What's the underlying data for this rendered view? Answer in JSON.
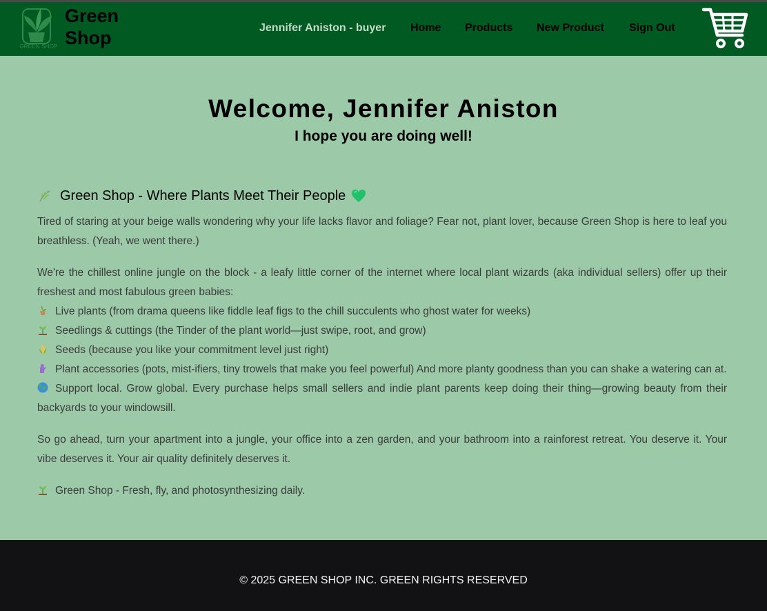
{
  "header": {
    "brand_line1": "Green",
    "brand_line2": "Shop",
    "logo_text": "GREEN SHOP",
    "user_label": "Jennifer Aniston - buyer",
    "nav": {
      "home": "Home",
      "products": "Products",
      "new_product": "New Product",
      "sign_out": "Sign Out"
    },
    "cart_icon": "shopping-cart-icon"
  },
  "hero": {
    "title": "Welcome, Jennifer Aniston",
    "subtitle": "I hope you are doing well!"
  },
  "about": {
    "title": "Green Shop - Where Plants Meet Their People",
    "intro": "Tired of staring at your beige walls wondering why your life lacks flavor and foliage? Fear not, plant lover, because Green Shop is here to leaf you breathless. (Yeah, we went there.)",
    "jungle": "We're the chillest online jungle on the block - a leafy little corner of the internet where local plant wizards (aka individual sellers) offer up their freshest and most fabulous green babies:",
    "items": [
      "Live plants (from drama queens like fiddle leaf figs to the chill succulents who ghost water for weeks)",
      "Seedlings & cuttings (the Tinder of the plant world—just swipe, root, and grow)",
      "Seeds (because you like your commitment level just right)",
      "Plant accessories (pots, mist-ifiers, tiny trowels that make you feel powerful) And more planty goodness than you can shake a watering can at.",
      "Support local. Grow global. Every purchase helps small sellers and indie plant parents keep doing their thing—growing beauty from their backyards to your windowsill."
    ],
    "outro": "So go ahead, turn your apartment into a jungle, your office into a zen garden, and your bathroom into a rainforest retreat. You deserve it. Your vibe deserves it. Your air quality definitely deserves it.",
    "tagline": "Green Shop - Fresh, fly, and photosynthesizing daily."
  },
  "footer": {
    "text": "© 2025 GREEN SHOP INC. GREEN RIGHTS RESERVED"
  },
  "colors": {
    "navbar": "#005a22",
    "page_bg": "#9ccaa9",
    "footer_bg": "#121214"
  }
}
